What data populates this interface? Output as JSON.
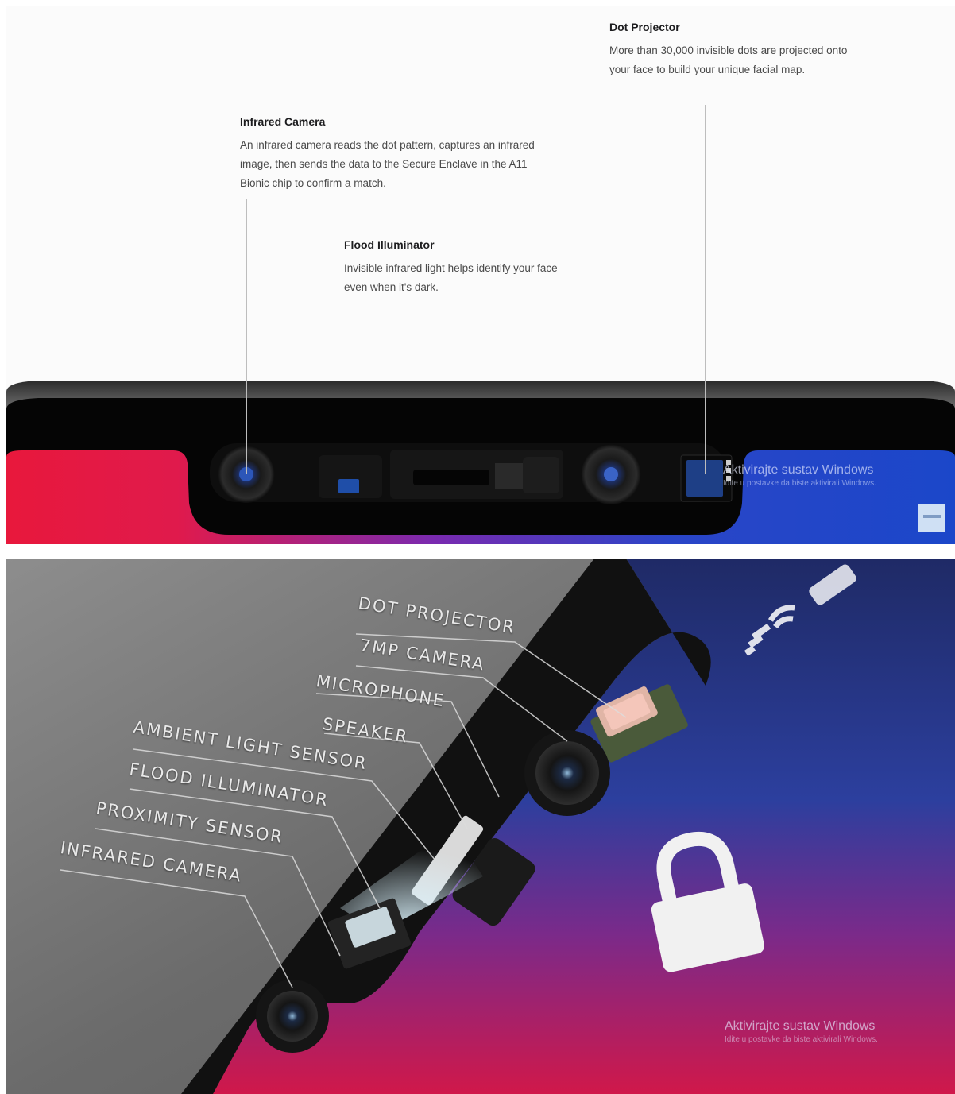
{
  "top_panel": {
    "callouts": [
      {
        "title": "Dot Projector",
        "body": "More than 30,000 invisible dots are projected onto your face to build your unique facial map."
      },
      {
        "title": "Infrared Camera",
        "body": "An infrared camera reads the dot pattern, captures an infrared image, then sends the data to the Secure Enclave in the A11 Bionic chip to confirm a match."
      },
      {
        "title": "Flood Illuminator",
        "body": "Invisible infrared light helps identify your face even when it's dark."
      }
    ],
    "watermark": {
      "title": "Aktivirajte sustav Windows",
      "subtitle": "Idite u postavke da biste aktivirali Windows."
    }
  },
  "bottom_panel": {
    "labels": [
      "DOT PROJECTOR",
      "7MP CAMERA",
      "MICROPHONE",
      "SPEAKER",
      "AMBIENT LIGHT SENSOR",
      "FLOOD ILLUMINATOR",
      "PROXIMITY SENSOR",
      "INFRARED CAMERA"
    ],
    "watermark": {
      "title": "Aktivirajte sustav Windows",
      "subtitle": "Idite u postavke da biste aktivirali Windows."
    }
  },
  "colors": {
    "screen_red": "#e8183c",
    "screen_blue": "#1b47c9",
    "bezel": "#050505",
    "label_text": "#e9e9e9"
  },
  "icons": [
    "lock-icon",
    "wifi-icon",
    "signal-icon"
  ]
}
